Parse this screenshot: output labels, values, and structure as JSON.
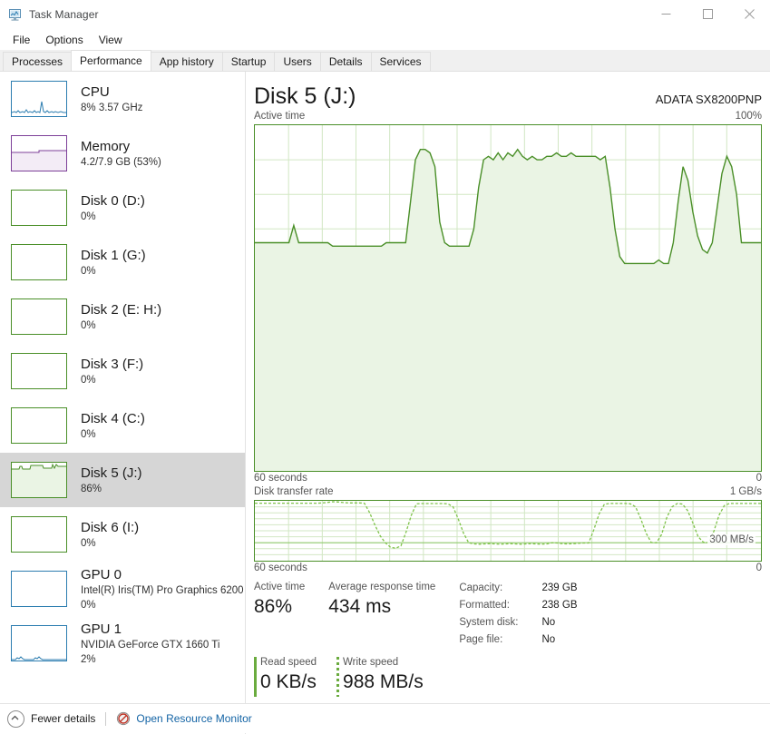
{
  "window": {
    "title": "Task Manager",
    "icon": "task-manager-icon",
    "controls": {
      "minimize": "minimize-icon",
      "maximize": "maximize-icon",
      "close": "close-icon"
    }
  },
  "menu": {
    "items": [
      "File",
      "Options",
      "View"
    ]
  },
  "tabs": {
    "items": [
      "Processes",
      "Performance",
      "App history",
      "Startup",
      "Users",
      "Details",
      "Services"
    ],
    "active": "Performance"
  },
  "sidebar": {
    "items": [
      {
        "name": "CPU",
        "sub": "8%  3.57 GHz",
        "kind": "cpu",
        "selected": false
      },
      {
        "name": "Memory",
        "sub": "4.2/7.9 GB (53%)",
        "kind": "mem",
        "selected": false
      },
      {
        "name": "Disk 0 (D:)",
        "sub": "0%",
        "kind": "disk",
        "selected": false
      },
      {
        "name": "Disk 1 (G:)",
        "sub": "0%",
        "kind": "disk",
        "selected": false
      },
      {
        "name": "Disk 2 (E: H:)",
        "sub": "0%",
        "kind": "disk",
        "selected": false
      },
      {
        "name": "Disk 3 (F:)",
        "sub": "0%",
        "kind": "disk",
        "selected": false
      },
      {
        "name": "Disk 4 (C:)",
        "sub": "0%",
        "kind": "disk",
        "selected": false
      },
      {
        "name": "Disk 5 (J:)",
        "sub": "86%",
        "kind": "disk-active",
        "selected": true
      },
      {
        "name": "Disk 6 (I:)",
        "sub": "0%",
        "kind": "disk",
        "selected": false
      },
      {
        "name": "GPU 0",
        "sub": "Intel(R) Iris(TM) Pro Graphics 6200",
        "sub2": "0%",
        "kind": "gpu",
        "selected": false
      },
      {
        "name": "GPU 1",
        "sub": "NVIDIA GeForce GTX 1660 Ti",
        "sub2": "2%",
        "kind": "gpu-active",
        "selected": false
      }
    ]
  },
  "main": {
    "title": "Disk 5 (J:)",
    "device": "ADATA SX8200PNP",
    "active_graph": {
      "label": "Active time",
      "max_label": "100%",
      "x_label": "60 seconds",
      "x_right": "0"
    },
    "rate_graph": {
      "label": "Disk transfer rate",
      "max_label": "1 GB/s",
      "marker_label": "300 MB/s",
      "x_label": "60 seconds",
      "x_right": "0"
    },
    "stats": {
      "active_time_label": "Active time",
      "active_time_value": "86%",
      "response_label": "Average response time",
      "response_value": "434 ms",
      "read_label": "Read speed",
      "read_value": "0 KB/s",
      "write_label": "Write speed",
      "write_value": "988 MB/s"
    },
    "info": [
      {
        "label": "Capacity:",
        "value": "239 GB"
      },
      {
        "label": "Formatted:",
        "value": "238 GB"
      },
      {
        "label": "System disk:",
        "value": "No"
      },
      {
        "label": "Page file:",
        "value": "No"
      }
    ]
  },
  "footer": {
    "fewer_details": "Fewer details",
    "fewer_details_icon": "chevron-up-circle-icon",
    "resource_monitor": "Open Resource Monitor",
    "resource_monitor_icon": "resource-monitor-icon"
  },
  "colors": {
    "disk_line": "#4a8f28",
    "disk_fill": "#eaf4e4",
    "cpu_line": "#2c7db0",
    "mem_line": "#7d3f98",
    "rate_line": "#7fc34a",
    "selected_row": "#d6d6d6",
    "link": "#1464a5"
  },
  "chart_data": [
    {
      "type": "area",
      "title": "Active time",
      "ylabel": "",
      "xlabel": "60 seconds",
      "ylim": [
        0,
        100
      ],
      "xlim": [
        60,
        0
      ],
      "grid": true,
      "y_ticks": [
        "100%",
        "0"
      ],
      "series": [
        {
          "name": "Active time",
          "values": [
            66,
            66,
            66,
            66,
            66,
            66,
            66,
            66,
            71,
            66,
            66,
            66,
            66,
            66,
            66,
            66,
            65,
            65,
            65,
            65,
            65,
            65,
            65,
            65,
            65,
            65,
            65,
            66,
            66,
            66,
            66,
            66,
            78,
            90,
            93,
            93,
            92,
            88,
            72,
            66,
            65,
            65,
            65,
            65,
            65,
            70,
            82,
            90,
            91,
            90,
            92,
            90,
            92,
            91,
            93,
            91,
            90,
            91,
            90,
            90,
            91,
            91,
            91,
            92,
            91,
            91,
            92,
            91,
            91,
            92,
            91,
            91,
            91,
            91,
            91,
            90,
            91,
            82,
            70,
            62,
            60,
            60,
            60,
            60,
            60,
            60,
            60,
            61,
            60,
            60,
            66,
            78,
            88,
            84,
            75,
            68,
            64,
            63,
            66,
            76,
            86,
            91,
            88,
            80,
            66
          ]
        }
      ]
    },
    {
      "type": "line",
      "title": "Disk transfer rate",
      "ylabel": "",
      "xlabel": "60 seconds",
      "ylim": [
        0,
        1000
      ],
      "xlim": [
        60,
        0
      ],
      "grid": true,
      "y_ticks": [
        "1 GB/s",
        "0"
      ],
      "annotations": [
        {
          "text": "300 MB/s",
          "y": 300
        }
      ],
      "series": [
        {
          "name": "Disk transfer rate",
          "values": [
            960,
            960,
            960,
            960,
            960,
            960,
            960,
            960,
            960,
            960,
            960,
            960,
            960,
            965,
            975,
            985,
            980,
            970,
            965,
            965,
            965,
            960,
            830,
            600,
            420,
            300,
            230,
            210,
            250,
            480,
            760,
            950,
            955,
            955,
            955,
            955,
            955,
            950,
            900,
            700,
            460,
            300,
            280,
            275,
            280,
            290,
            285,
            280,
            290,
            285,
            275,
            280,
            290,
            285,
            280,
            285,
            290,
            285,
            280,
            275,
            280,
            290,
            300,
            295,
            285,
            280,
            290,
            285,
            280,
            285,
            290,
            290,
            520,
            780,
            940,
            955,
            955,
            955,
            955,
            950,
            900,
            700,
            460,
            305,
            300,
            440,
            700,
            900,
            945,
            930,
            820,
            620,
            430,
            310,
            300,
            520,
            760,
            940,
            955
          ]
        }
      ]
    }
  ]
}
